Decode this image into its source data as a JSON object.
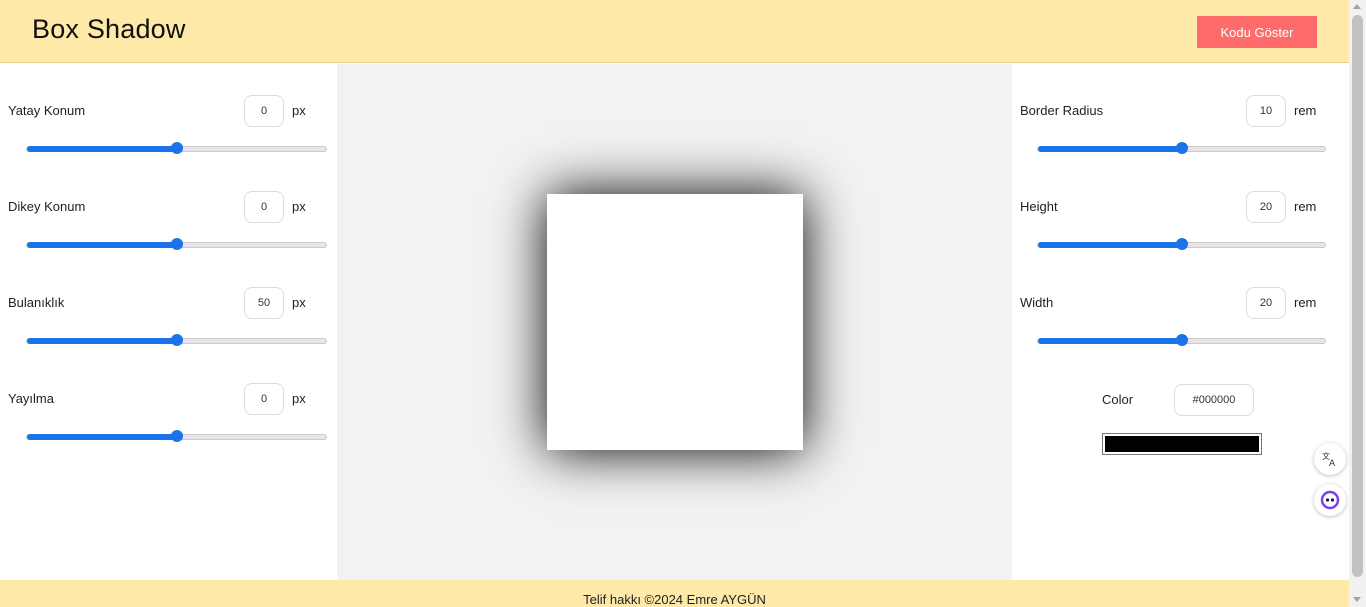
{
  "header": {
    "title": "Box Shadow",
    "code_button": "Kodu Göster"
  },
  "left_controls": [
    {
      "label": "Yatay Konum",
      "value": "0",
      "unit": "px",
      "slider_fraction": 0.5
    },
    {
      "label": "Dikey Konum",
      "value": "0",
      "unit": "px",
      "slider_fraction": 0.5
    },
    {
      "label": "Bulanıklık",
      "value": "50",
      "unit": "px",
      "slider_fraction": 0.5
    },
    {
      "label": "Yayılma",
      "value": "0",
      "unit": "px",
      "slider_fraction": 0.5
    }
  ],
  "right_controls": [
    {
      "label": "Border Radius",
      "value": "10",
      "unit": "rem",
      "slider_fraction": 0.5
    },
    {
      "label": "Height",
      "value": "20",
      "unit": "rem",
      "slider_fraction": 0.5
    },
    {
      "label": "Width",
      "value": "20",
      "unit": "rem",
      "slider_fraction": 0.5
    }
  ],
  "color": {
    "label": "Color",
    "value": "#000000",
    "swatch": "#000000"
  },
  "footer": {
    "text": "Telif hakkı ©2024 Emre AYGÜN"
  },
  "floating_buttons": [
    {
      "icon": "translate-icon"
    },
    {
      "icon": "assistant-icon"
    }
  ],
  "accent_colors": {
    "header_bg": "#ffe9a8",
    "button_bg": "#ff6b6b",
    "slider": "#1a73e8"
  }
}
